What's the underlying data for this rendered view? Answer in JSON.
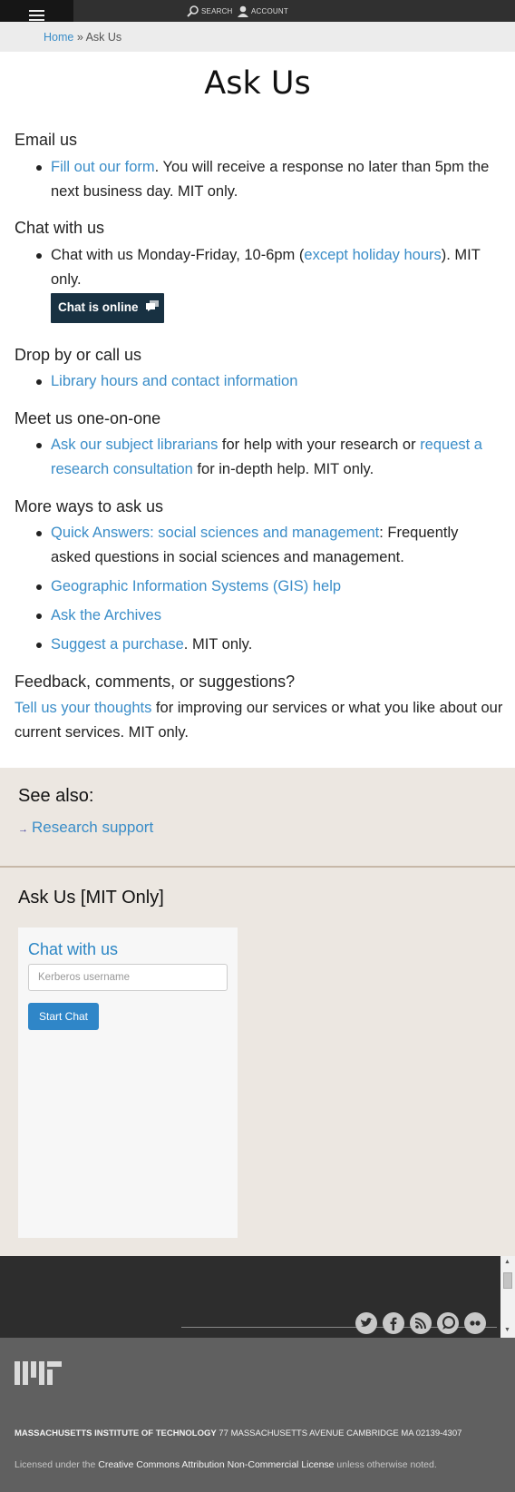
{
  "topnav": {
    "search": "SEARCH",
    "account": "ACCOUNT"
  },
  "breadcrumb": {
    "home": "Home",
    "sep": " » ",
    "current": "Ask Us"
  },
  "title": "Ask Us",
  "email": {
    "heading": "Email us",
    "link": "Fill out our form",
    "text": ". You will receive a response no later than 5pm the next business day. MIT only."
  },
  "chat": {
    "heading": "Chat with us",
    "text_before": "Chat with us Monday-Friday, 10-6pm (",
    "link": "except holiday hours",
    "text_after": "). MIT only.",
    "status_button": "Chat is online"
  },
  "drop": {
    "heading": "Drop by or call us",
    "link": "Library hours and contact information"
  },
  "meet": {
    "heading": "Meet us one-on-one",
    "link1": "Ask our subject librarians",
    "text1": " for help with your research or ",
    "link2": "request a research consultation",
    "text2": " for in-depth help. MIT only."
  },
  "more": {
    "heading": "More ways to ask us",
    "items": [
      {
        "link": "Quick Answers: social sciences and management",
        "text": ": Frequently asked questions in social sciences and management."
      },
      {
        "link": "Geographic Information Systems (GIS) help",
        "text": ""
      },
      {
        "link": "Ask the Archives",
        "text": ""
      },
      {
        "link": "Suggest a purchase",
        "text": ". MIT only."
      }
    ]
  },
  "feedback": {
    "heading": "Feedback, comments, or suggestions?",
    "link": "Tell us your thoughts",
    "text": " for improving our services or what you like about our current services. MIT only."
  },
  "see_also": {
    "heading": "See also:",
    "arrow": "→",
    "link": "Research support"
  },
  "ask_mit": {
    "heading": "Ask Us [MIT Only]",
    "widget_title": "Chat with us",
    "input_placeholder": "Kerberos username",
    "button": "Start Chat"
  },
  "social_icons": [
    "twitter-icon",
    "facebook-icon",
    "rss-icon",
    "chat-icon",
    "flickr-icon"
  ],
  "footer": {
    "institution": "MASSACHUSETTS INSTITUTE OF TECHNOLOGY",
    "address": " 77 MASSACHUSETTS AVENUE CAMBRIDGE MA 02139-4307",
    "license_before": "Licensed under the ",
    "license_link": "Creative Commons Attribution Non-Commercial License",
    "license_after": " unless otherwise noted."
  },
  "colors": {
    "link": "#3a8dc8",
    "chat_button": "#183142",
    "beige": "#ece7e1",
    "footer": "#606060",
    "start_chat": "#2f86c8"
  }
}
